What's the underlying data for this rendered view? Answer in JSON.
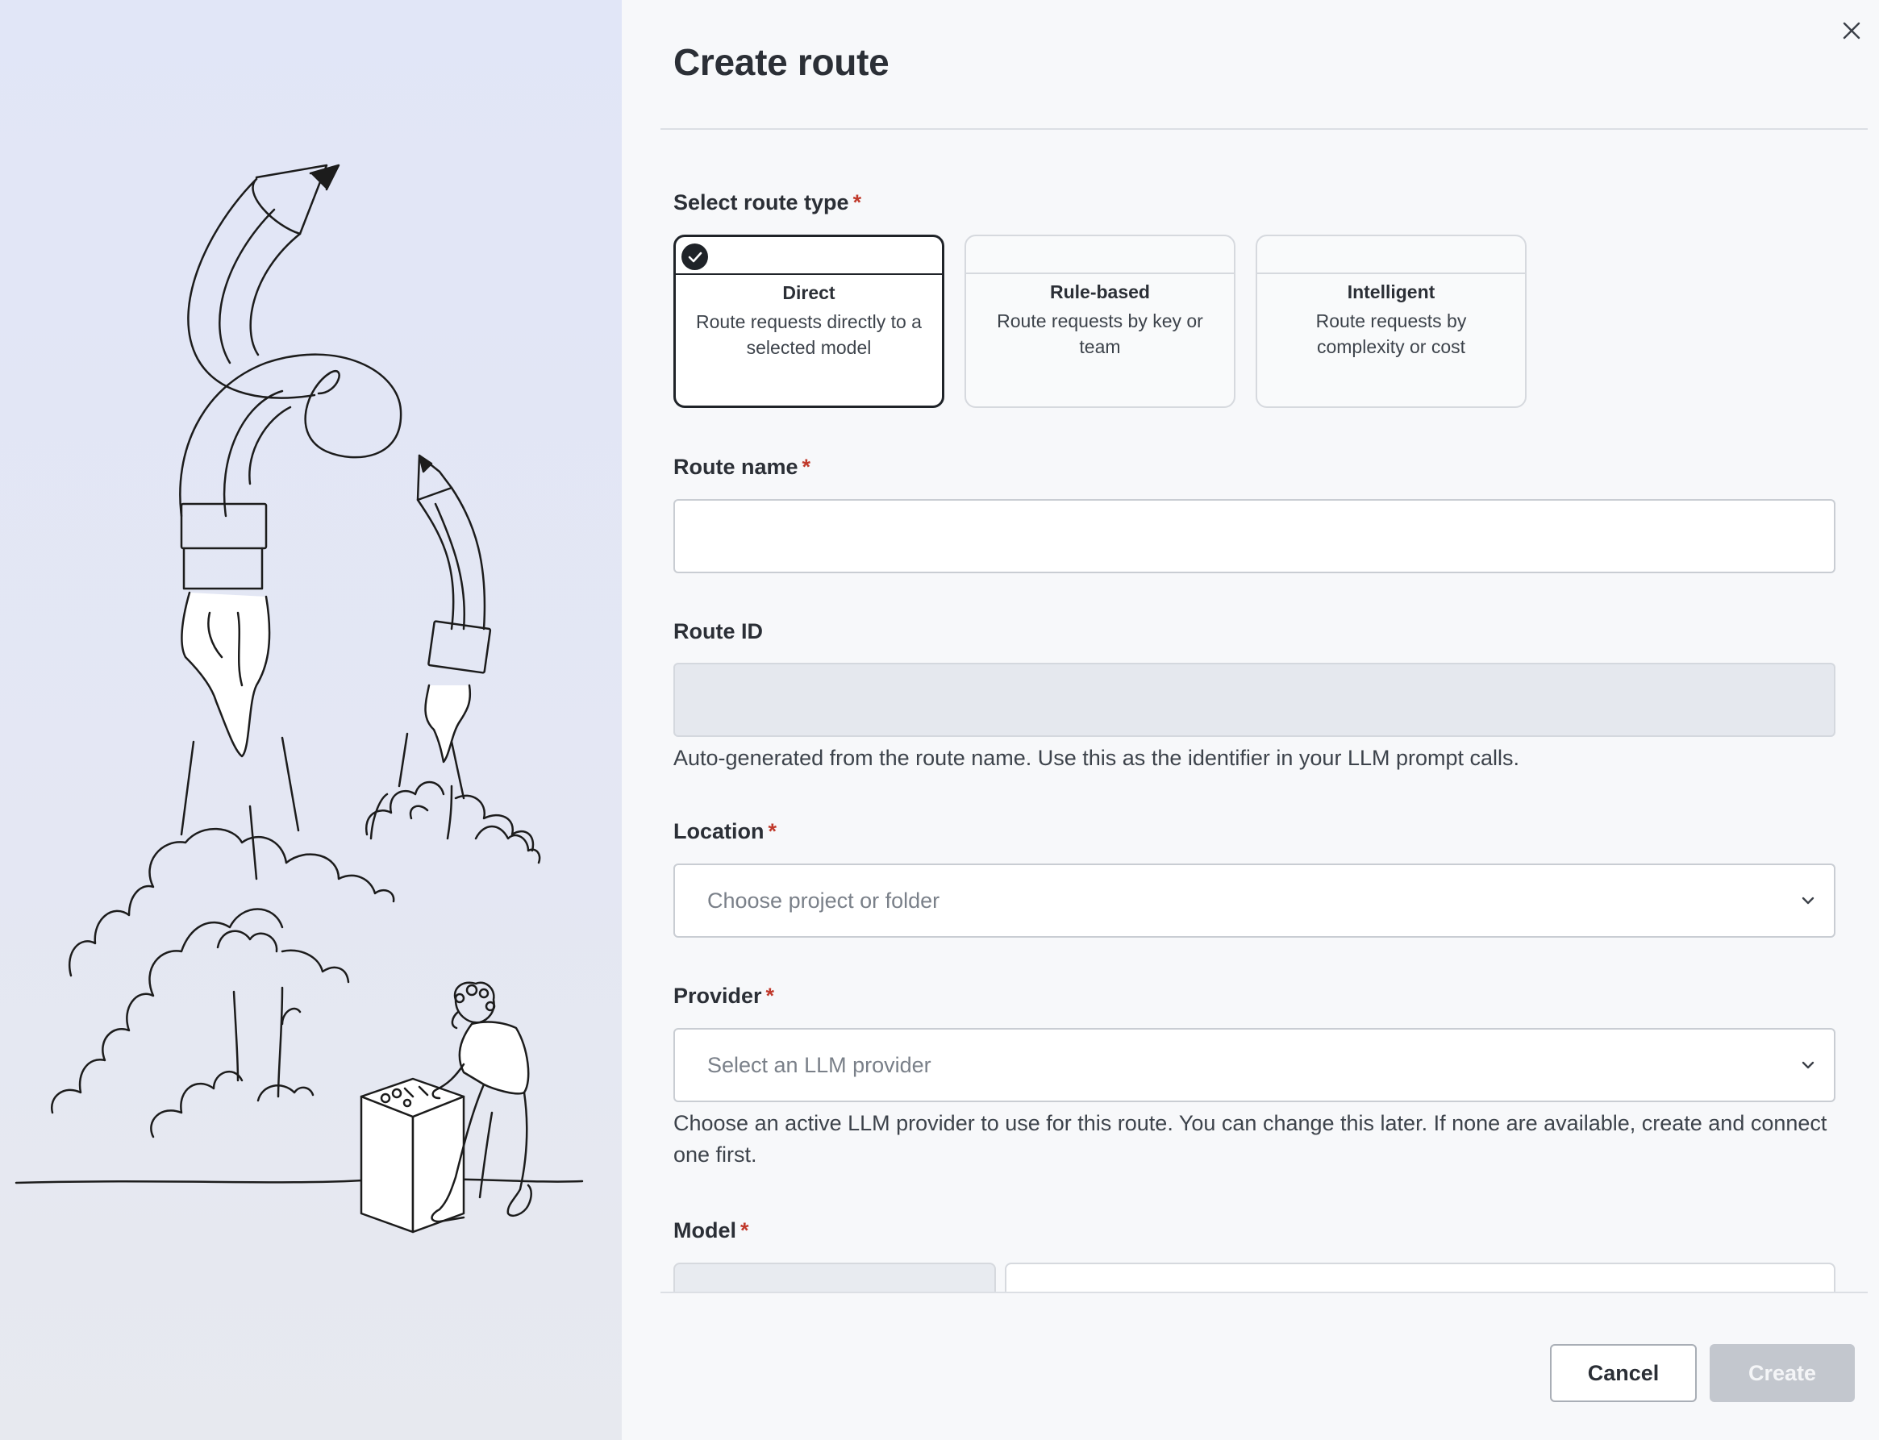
{
  "dialog": {
    "title": "Create route",
    "close_label": "Close"
  },
  "route_type": {
    "label": "Select route type",
    "required_mark": "*",
    "options": [
      {
        "title": "Direct",
        "description": "Route requests directly to a selected model",
        "selected": true
      },
      {
        "title": "Rule-based",
        "description": "Route requests by key or team",
        "selected": false
      },
      {
        "title": "Intelligent",
        "description": "Route requests by complexity or cost",
        "selected": false
      }
    ]
  },
  "route_name": {
    "label": "Route name",
    "required_mark": "*",
    "value": ""
  },
  "route_id": {
    "label": "Route ID",
    "value": "",
    "help": "Auto-generated from the route name. Use this as the identifier in your LLM prompt calls."
  },
  "location": {
    "label": "Location",
    "required_mark": "*",
    "placeholder": "Choose project or folder"
  },
  "provider": {
    "label": "Provider",
    "required_mark": "*",
    "placeholder": "Select an LLM provider",
    "help": "Choose an active LLM provider to use for this route. You can change this later. If none are available, create and connect one first."
  },
  "model": {
    "label": "Model",
    "required_mark": "*"
  },
  "footer": {
    "cancel_label": "Cancel",
    "create_label": "Create"
  },
  "colors": {
    "required": "#c0392b",
    "selected_border": "#1f2328",
    "disabled_button": "#c3c7ce",
    "illustration_bg": "#e1e6f7"
  }
}
